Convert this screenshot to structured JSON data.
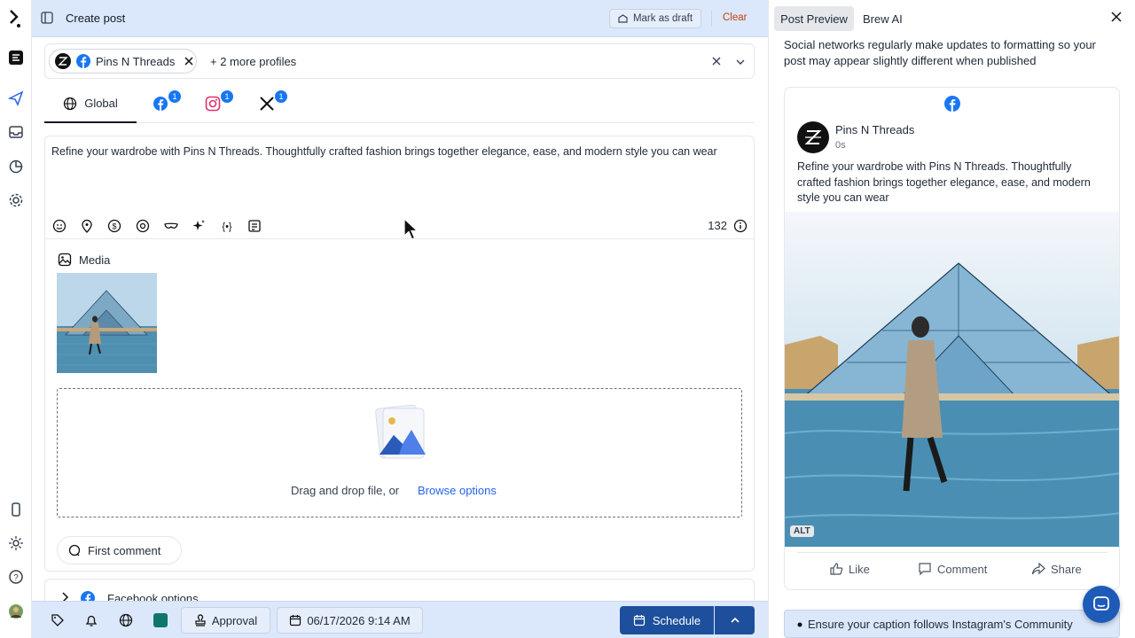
{
  "header": {
    "title": "Create post",
    "draft_label": "Mark as draft",
    "clear_label": "Clear"
  },
  "profiles": {
    "chip_name": "Pins N Threads",
    "more_label": "+ 2 more profiles"
  },
  "tabs": {
    "global_label": "Global",
    "facebook_badge": "1",
    "instagram_badge": "1",
    "x_badge": "1"
  },
  "editor": {
    "text": "Refine your wardrobe with Pins N Threads. Thoughtfully crafted fashion brings together elegance, ease, and modern style you can wear",
    "char_count": "132"
  },
  "media": {
    "label": "Media",
    "drop_text": "Drag and drop file, or",
    "browse_label": "Browse options"
  },
  "comment": {
    "label": "First comment"
  },
  "facebook_options": {
    "label": "Facebook options"
  },
  "bottombar": {
    "approval_label": "Approval",
    "date_label": "06/17/2026 9:14 AM",
    "schedule_label": "Schedule"
  },
  "preview": {
    "tab_preview": "Post Preview",
    "tab_brew": "Brew AI",
    "note": "Social networks regularly make updates to formatting so your post may appear slightly different when published",
    "page_name": "Pins N Threads",
    "time": "0s",
    "post_text": "Refine your wardrobe with Pins N Threads. Thoughtfully crafted fashion brings together elegance, ease, and modern style you can wear",
    "alt_label": "ALT",
    "like_label": "Like",
    "comment_label": "Comment",
    "share_label": "Share",
    "guideline": "Ensure your caption follows Instagram's Community"
  },
  "colors": {
    "accent": "#1e4f9c",
    "topbar": "#dbe8fb",
    "facebook": "#1877f2",
    "clear": "#c2410c"
  }
}
